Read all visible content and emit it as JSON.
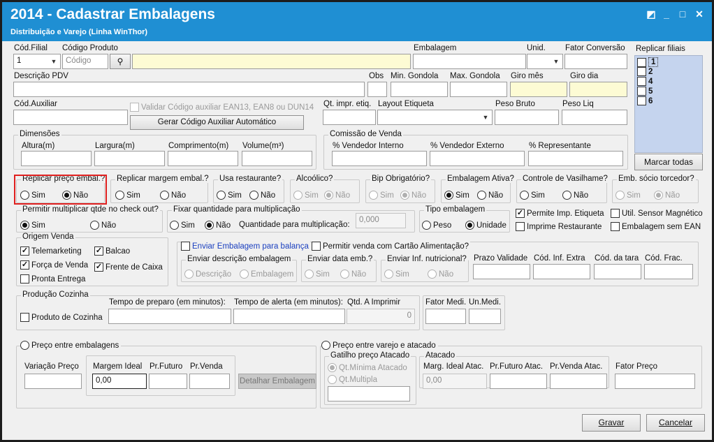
{
  "window": {
    "title": "2014 - Cadastrar Embalagens",
    "subtitle": "Distribuição e Varejo (Linha WinThor)"
  },
  "row1": {
    "cod_filial_label": "Cód.Filial",
    "cod_filial_value": "1",
    "codigo_produto_label": "Código Produto",
    "codigo_placeholder": "Código",
    "embalagem_label": "Embalagem",
    "unid_label": "Unid.",
    "fator_conversao_label": "Fator Conversão"
  },
  "row2": {
    "descricao_pdv_label": "Descrição PDV",
    "obs_label": "Obs",
    "min_gondola_label": "Min. Gondola",
    "max_gondola_label": "Max. Gondola",
    "giro_mes_label": "Giro mês",
    "giro_dia_label": "Giro dia"
  },
  "row3": {
    "cod_auxiliar_label": "Cód.Auxiliar",
    "validar_label": "Validar Código auxiliar EAN13, EAN8 ou DUN14",
    "gerar_button": "Gerar Código Auxiliar Automático",
    "qt_impr_label": "Qt. impr. etiq.",
    "layout_label": "Layout Etiqueta",
    "peso_bruto_label": "Peso Bruto",
    "peso_liq_label": "Peso Liq"
  },
  "dimensoes": {
    "title": "Dimensões",
    "altura": "Altura(m)",
    "largura": "Largura(m)",
    "comprimento": "Comprimento(m)",
    "volume": "Volume(m³)"
  },
  "comissao": {
    "title": "Comissão de Venda",
    "vendedor_interno": "% Vendedor Interno",
    "vendedor_externo": "% Vendedor Externo",
    "representante": "% Representante"
  },
  "replicar_filiais": {
    "title": "Replicar filiais",
    "items": [
      "1",
      "2",
      "4",
      "5",
      "6"
    ],
    "marcar_todas": "Marcar todas"
  },
  "opts": {
    "sim": "Sim",
    "nao": "Não"
  },
  "groups_row": {
    "replicar_preco": "Replicar preço embal.?",
    "replicar_margem": "Replicar margem embal.?",
    "usa_restaurante": "Usa restaurante?",
    "alcoolico": "Alcoólico?",
    "bip": "Bip Obrigatório?",
    "emb_ativa": "Embalagem Ativa?",
    "controle_vasilhame": "Controle de Vasilhame?",
    "emb_socio": "Emb. sócio torcedor?"
  },
  "permitir_multiplicar": "Permitir multiplicar qtde no check out?",
  "fixar": {
    "title": "Fixar quantidade para multiplicação",
    "qtd_label": "Quantidade para multiplicação:",
    "qtd_value": "0,000"
  },
  "tipo_embalagem": {
    "title": "Tipo embalagem",
    "peso": "Peso",
    "unidade": "Unidade"
  },
  "checks_right": {
    "permite_imp": "Permite Imp. Etiqueta",
    "util_sensor": "Util. Sensor Magnético",
    "imprime_rest": "Imprime Restaurante",
    "emb_sem_ean": "Embalagem sem EAN"
  },
  "origem": {
    "title": "Origem Venda",
    "telemarketing": "Telemarketing",
    "balcao": "Balcao",
    "forca": "Força de Venda",
    "frente": "Frente de Caixa",
    "pronta": "Pronta Entrega"
  },
  "balanca": {
    "enviar_label": "Enviar Embalagem para balança",
    "permitir_cartao": "Permitir venda com Cartão Alimentação?",
    "enviar_desc": "Enviar descrição embalagem",
    "descricao": "Descrição",
    "embalagem": "Embalagem",
    "enviar_data": "Enviar data emb.?",
    "enviar_inf": "Enviar Inf. nutricional?",
    "prazo": "Prazo Validade",
    "cod_inf_extra": "Cód. Inf. Extra",
    "cod_tara": "Cód. da tara",
    "cod_frac": "Cód. Frac."
  },
  "producao": {
    "title": "Produção Cozinha",
    "produto_cozinha": "Produto de Cozinha",
    "tempo_preparo": "Tempo de preparo (em minutos):",
    "tempo_alerta": "Tempo de alerta (em minutos):",
    "qtd_imprimir": "Qtd. A Imprimir",
    "qtd_value": "0"
  },
  "fator": {
    "fator_medi": "Fator Medi.",
    "un_medi": "Un.Medi."
  },
  "preco_emb": {
    "title": "Preço entre embalagens",
    "variacao": "Variação Preço",
    "margem_ideal": "Margem Ideal",
    "margem_value": "0,00",
    "pr_futuro": "Pr.Futuro",
    "pr_venda": "Pr.Venda",
    "detalhar": "Detalhar Embalagem"
  },
  "preco_varejo": {
    "title": "Preço entre varejo e atacado",
    "gatilho": "Gatilho preço Atacado",
    "qt_minima": "Qt.Mínima Atacado",
    "qt_multipla": "Qt.Multipla",
    "atacado": "Atacado",
    "marg_ideal_atac": "Marg. Ideal Atac.",
    "marg_value": "0,00",
    "pr_futuro_atac": "Pr.Futuro Atac.",
    "pr_venda_atac": "Pr.Venda Atac.",
    "fator_preco": "Fator Preço"
  },
  "footer": {
    "gravar": "Gravar",
    "cancelar": "Cancelar"
  },
  "colors": {
    "titlebar": "#1f8fd3",
    "highlight": "#e0201f",
    "filiais_bg": "#c5d4ee"
  }
}
